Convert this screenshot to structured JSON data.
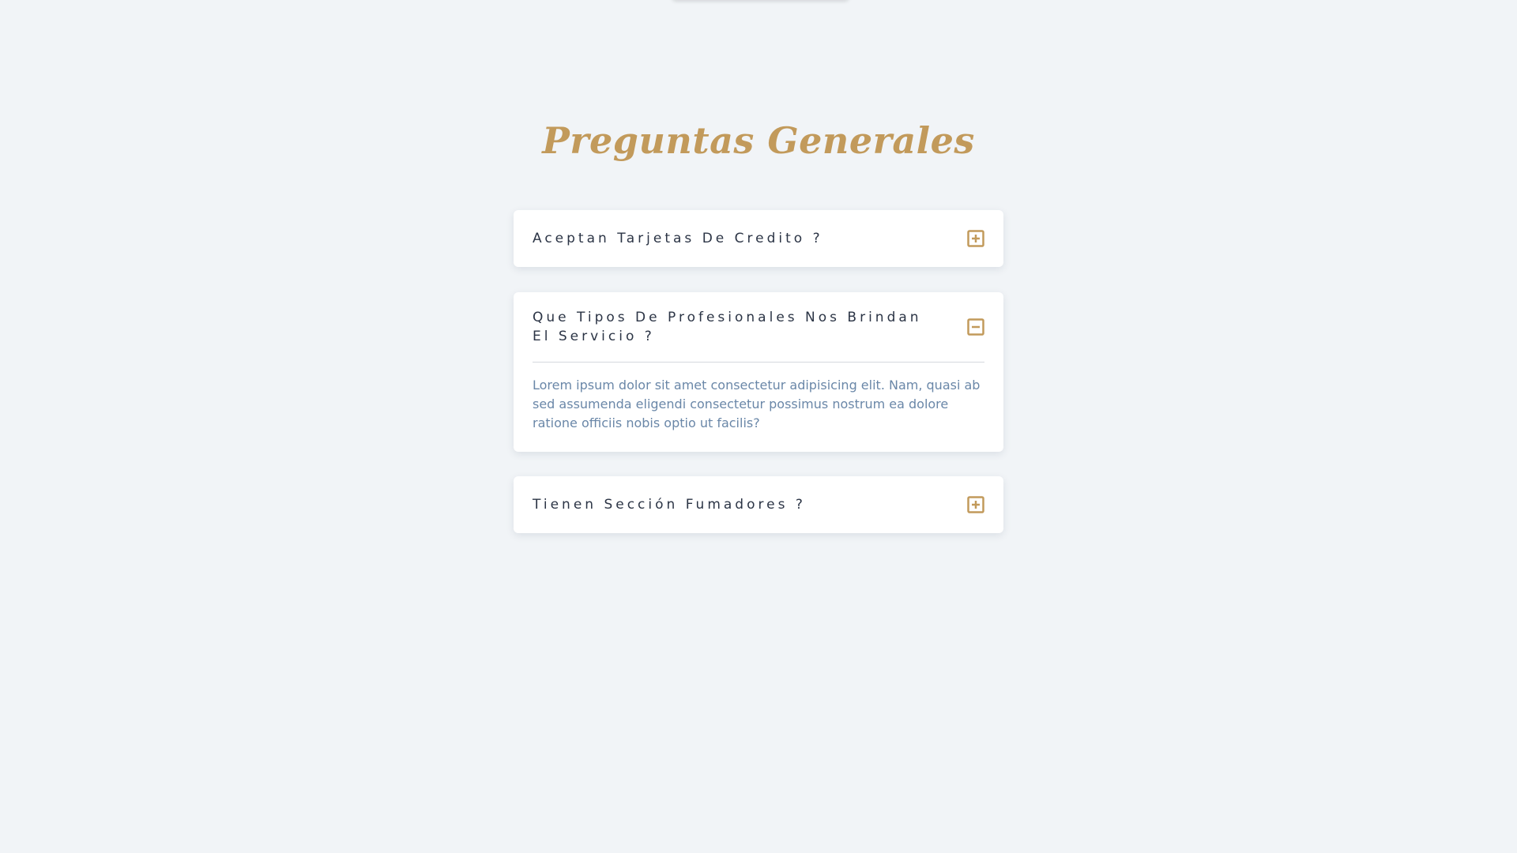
{
  "section_title": "Preguntas Generales",
  "faqs": [
    {
      "question": "Aceptan Tarjetas De Credito ?",
      "expanded": false,
      "icon": "plus-square-icon"
    },
    {
      "question": "Que Tipos De Profesionales Nos Brindan El Servicio ?",
      "expanded": true,
      "icon": "minus-square-icon",
      "answer": "Lorem ipsum dolor sit amet consectetur adipisicing elit. Nam, quasi ab sed assumenda eligendi consectetur possimus nostrum ea dolore ratione officiis nobis optio ut facilis?"
    },
    {
      "question": "Tienen Sección Fumadores ?",
      "expanded": false,
      "icon": "plus-square-icon"
    }
  ],
  "colors": {
    "background": "#f1f4f7",
    "accent": "#c29a5b",
    "question_text": "#2b3445",
    "answer_text": "#6a87a8"
  }
}
